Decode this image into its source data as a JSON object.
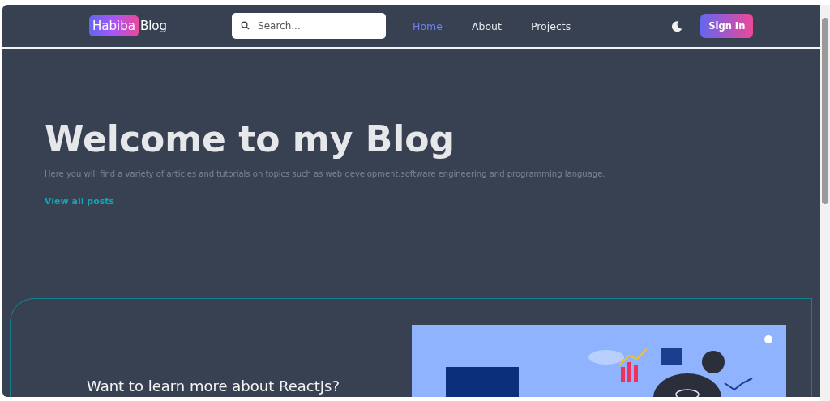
{
  "header": {
    "logo_badge": "Habiba",
    "logo_text": "Blog",
    "search": {
      "placeholder": "Search..."
    },
    "nav": [
      {
        "label": "Home",
        "selected": true
      },
      {
        "label": "About",
        "selected": false
      },
      {
        "label": "Projects",
        "selected": false
      }
    ],
    "sign_in": "Sign In"
  },
  "hero": {
    "title": "Welcome to my Blog",
    "subtitle": "Here you will find a variety of articles and tutorials on topics such as web development,software engineering and programming language.",
    "link": "View all posts"
  },
  "promo": {
    "heading": "Want to learn more about ReactJs?"
  }
}
